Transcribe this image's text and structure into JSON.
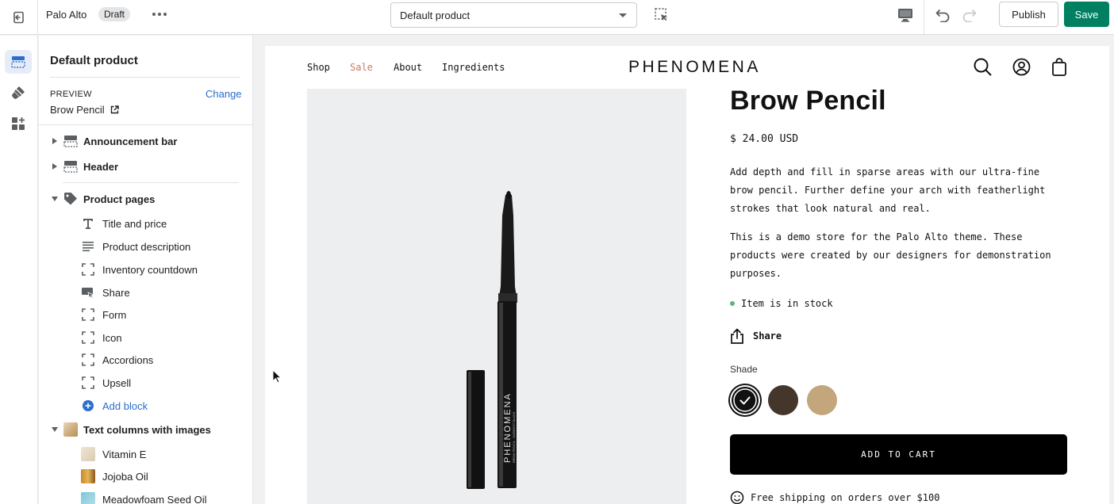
{
  "topbar": {
    "theme_name": "Palo Alto",
    "status_badge": "Draft",
    "template_select": "Default product",
    "publish_label": "Publish",
    "save_label": "Save"
  },
  "sidebar": {
    "title": "Default product",
    "preview_label": "PREVIEW",
    "change_label": "Change",
    "preview_product": "Brow Pencil",
    "sections": [
      {
        "label": "Announcement bar"
      },
      {
        "label": "Header"
      },
      {
        "label": "Product pages"
      },
      {
        "label": "Text columns with images"
      }
    ],
    "product_blocks": [
      {
        "label": "Title and price",
        "icon": "text-icon"
      },
      {
        "label": "Product description",
        "icon": "paragraph-icon"
      },
      {
        "label": "Inventory countdown",
        "icon": "block-icon"
      },
      {
        "label": "Share",
        "icon": "share-icon"
      },
      {
        "label": "Form",
        "icon": "block-icon"
      },
      {
        "label": "Icon",
        "icon": "block-icon"
      },
      {
        "label": "Accordions",
        "icon": "block-icon"
      },
      {
        "label": "Upsell",
        "icon": "block-icon"
      }
    ],
    "add_block_label": "Add block",
    "text_column_blocks": [
      {
        "label": "Vitamin E"
      },
      {
        "label": "Jojoba Oil"
      },
      {
        "label": "Meadowfoam Seed Oil"
      }
    ]
  },
  "store": {
    "nav": [
      "Shop",
      "Sale",
      "About",
      "Ingredients"
    ],
    "logo": "PHENOMENA",
    "product_title": "Brow Pencil",
    "price": "$ 24.00 USD",
    "description_1": "Add depth and fill in sparse areas with our ultra-fine brow pencil. Further define your arch with featherlight strokes that look natural and real.",
    "description_2": "This is a demo store for the Palo Alto theme. These products were created by our designers for demonstration purposes.",
    "stock_text": "Item is in stock",
    "share_label": "Share",
    "shade_label": "Shade",
    "shades": [
      "#111111",
      "#45362c",
      "#c4a67c"
    ],
    "add_to_cart": "ADD TO CART",
    "shipping_text": "Free shipping on orders over $100",
    "pencil_brand": "PHENOMENA",
    "pencil_subtext": "BROW PENCIL · DARKEST BLACK"
  },
  "colors": {
    "accent_link": "#2c6ecb",
    "save_green": "#008060",
    "sale_red": "#c97a66"
  }
}
